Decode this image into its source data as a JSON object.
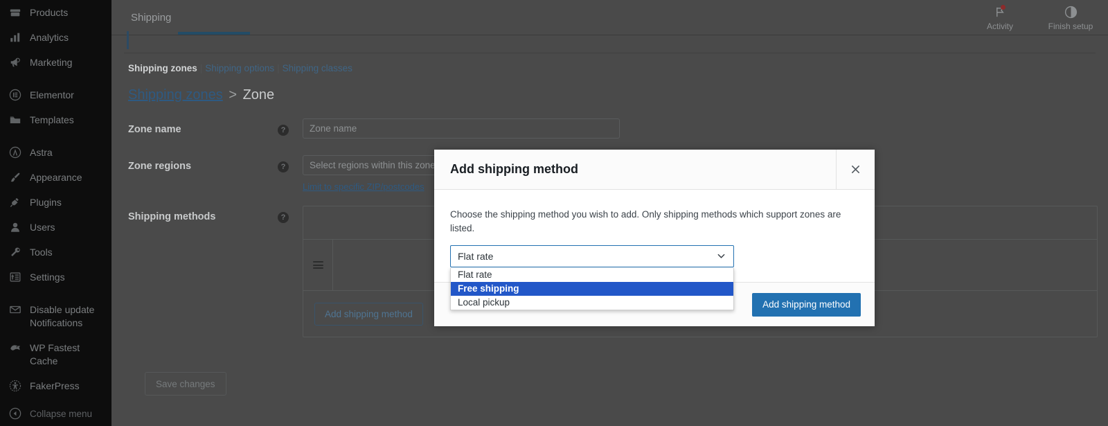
{
  "sidebar": {
    "items": [
      {
        "label": "Products",
        "icon": "products-icon",
        "gap_before": false
      },
      {
        "label": "Analytics",
        "icon": "analytics-icon",
        "gap_before": false
      },
      {
        "label": "Marketing",
        "icon": "marketing-icon",
        "gap_before": false
      },
      {
        "label": "Elementor",
        "icon": "elementor-icon",
        "gap_before": true
      },
      {
        "label": "Templates",
        "icon": "templates-folder-icon",
        "gap_before": false
      },
      {
        "label": "Astra",
        "icon": "astra-icon",
        "gap_before": true
      },
      {
        "label": "Appearance",
        "icon": "paintbrush-icon",
        "gap_before": false
      },
      {
        "label": "Plugins",
        "icon": "plug-icon",
        "gap_before": false
      },
      {
        "label": "Users",
        "icon": "user-icon",
        "gap_before": false
      },
      {
        "label": "Tools",
        "icon": "wrench-icon",
        "gap_before": false
      },
      {
        "label": "Settings",
        "icon": "settings-sliders-icon",
        "gap_before": false
      },
      {
        "label": "Disable update Notifications",
        "icon": "envelope-icon",
        "gap_before": true
      },
      {
        "label": "WP Fastest Cache",
        "icon": "cheetah-icon",
        "gap_before": false
      },
      {
        "label": "FakerPress",
        "icon": "accessibility-icon",
        "gap_before": false
      }
    ],
    "collapse": {
      "label": "Collapse menu",
      "icon": "collapse-arrow-icon"
    }
  },
  "header": {
    "title": "Shipping",
    "activity": {
      "label": "Activity",
      "icon": "flag-icon",
      "has_badge": true
    },
    "finish_setup": {
      "label": "Finish setup",
      "icon": "half-circle-icon"
    }
  },
  "subnav": {
    "items": [
      {
        "label": "Shipping zones",
        "current": true
      },
      {
        "label": "Shipping options",
        "current": false
      },
      {
        "label": "Shipping classes",
        "current": false
      }
    ],
    "separator": "|"
  },
  "breadcrumb": {
    "link": "Shipping zones",
    "separator": ">",
    "current": "Zone"
  },
  "form": {
    "zone_name": {
      "label": "Zone name",
      "help": "?",
      "value": "",
      "placeholder": "Zone name"
    },
    "zone_regions": {
      "label": "Zone regions",
      "help": "?",
      "value": "",
      "placeholder": "Select regions within this zone",
      "limit_link": "Limit to specific ZIP/postcodes"
    },
    "shipping_methods": {
      "label": "Shipping methods",
      "help": "?",
      "add_button": "Add shipping method"
    },
    "save_button": "Save changes"
  },
  "modal": {
    "title": "Add shipping method",
    "close_icon": "close-icon",
    "description": "Choose the shipping method you wish to add. Only shipping methods which support zones are listed.",
    "select": {
      "value": "Flat rate",
      "chevron_icon": "chevron-down-icon",
      "options": [
        {
          "label": "Flat rate",
          "selected": false
        },
        {
          "label": "Free shipping",
          "selected": true
        },
        {
          "label": "Local pickup",
          "selected": false
        }
      ]
    },
    "submit_button": "Add shipping method"
  },
  "colors": {
    "sidebar_bg": "#0d0d0d",
    "overlay_bg": "#4a4a4a",
    "primary_blue": "#2271b1",
    "option_highlight": "#2257c8",
    "link_blue": "#2e5a82",
    "badge_red": "#8c2b2b"
  }
}
